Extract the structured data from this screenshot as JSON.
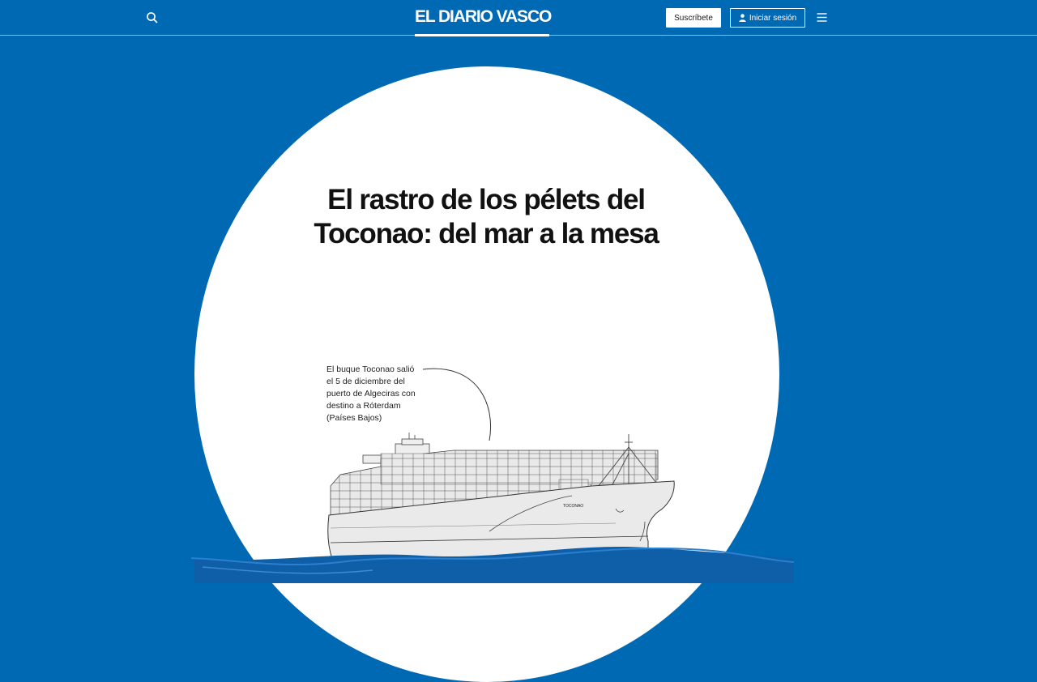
{
  "header": {
    "logo": "EL DIARIO VASCO",
    "subscribe_label": "Suscríbete",
    "login_label": "Iniciar sesión",
    "icons": {
      "search": "search-icon",
      "user": "user-icon",
      "menu": "hamburger-menu-icon"
    }
  },
  "hero": {
    "headline": "El rastro de los pélets del Toconao: del mar a la mesa",
    "caption": "El buque Toconao salió\nel 5 de diciembre del\npuerto de Algeciras con\ndestino a Róterdam\n(Países Bajos)",
    "ship_name": "TOCONAO"
  },
  "colors": {
    "background": "#0069b4",
    "moon": "#ffffff",
    "ink": "#111111",
    "sea": "#1460a8"
  }
}
